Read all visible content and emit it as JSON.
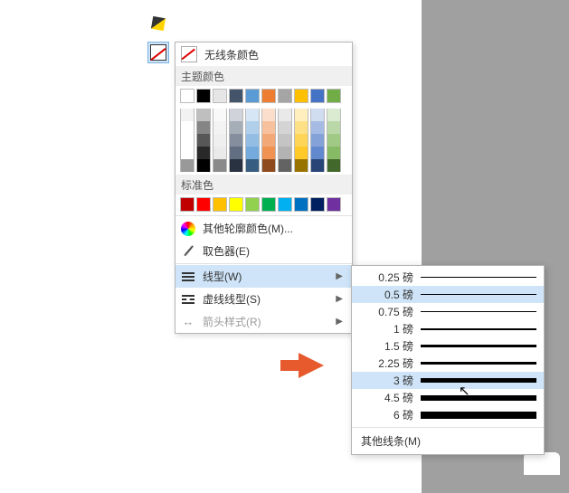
{
  "popup": {
    "no_line": "无线条颜色",
    "theme_label": "主题颜色",
    "standard_label": "标准色",
    "more_colors": "其他轮廓颜色(M)...",
    "color_picker": "取色器(E)",
    "line_weight": "线型(W)",
    "line_dash": "虚线线型(S)",
    "arrow_style": "箭头样式(R)"
  },
  "theme_colors": [
    "#ffffff",
    "#000000",
    "#e7e6e6",
    "#44546a",
    "#5b9bd5",
    "#ed7d31",
    "#a5a5a5",
    "#ffc000",
    "#4472c4",
    "#70ad47"
  ],
  "standard_colors": [
    "#c00000",
    "#ff0000",
    "#ffc000",
    "#ffff00",
    "#92d050",
    "#00b050",
    "#00b0f0",
    "#0070c0",
    "#002060",
    "#7030a0"
  ],
  "weights": [
    {
      "label": "0.25 磅",
      "px": 0.5
    },
    {
      "label": "0.5 磅",
      "px": 1
    },
    {
      "label": "0.75 磅",
      "px": 1.5
    },
    {
      "label": "1 磅",
      "px": 2
    },
    {
      "label": "1.5 磅",
      "px": 2.5
    },
    {
      "label": "2.25 磅",
      "px": 3.5
    },
    {
      "label": "3 磅",
      "px": 4.5
    },
    {
      "label": "4.5 磅",
      "px": 6
    },
    {
      "label": "6 磅",
      "px": 8
    }
  ],
  "weight_hover_index": 1,
  "weight_cursor_index": 6,
  "more_lines": "其他线条(M)"
}
